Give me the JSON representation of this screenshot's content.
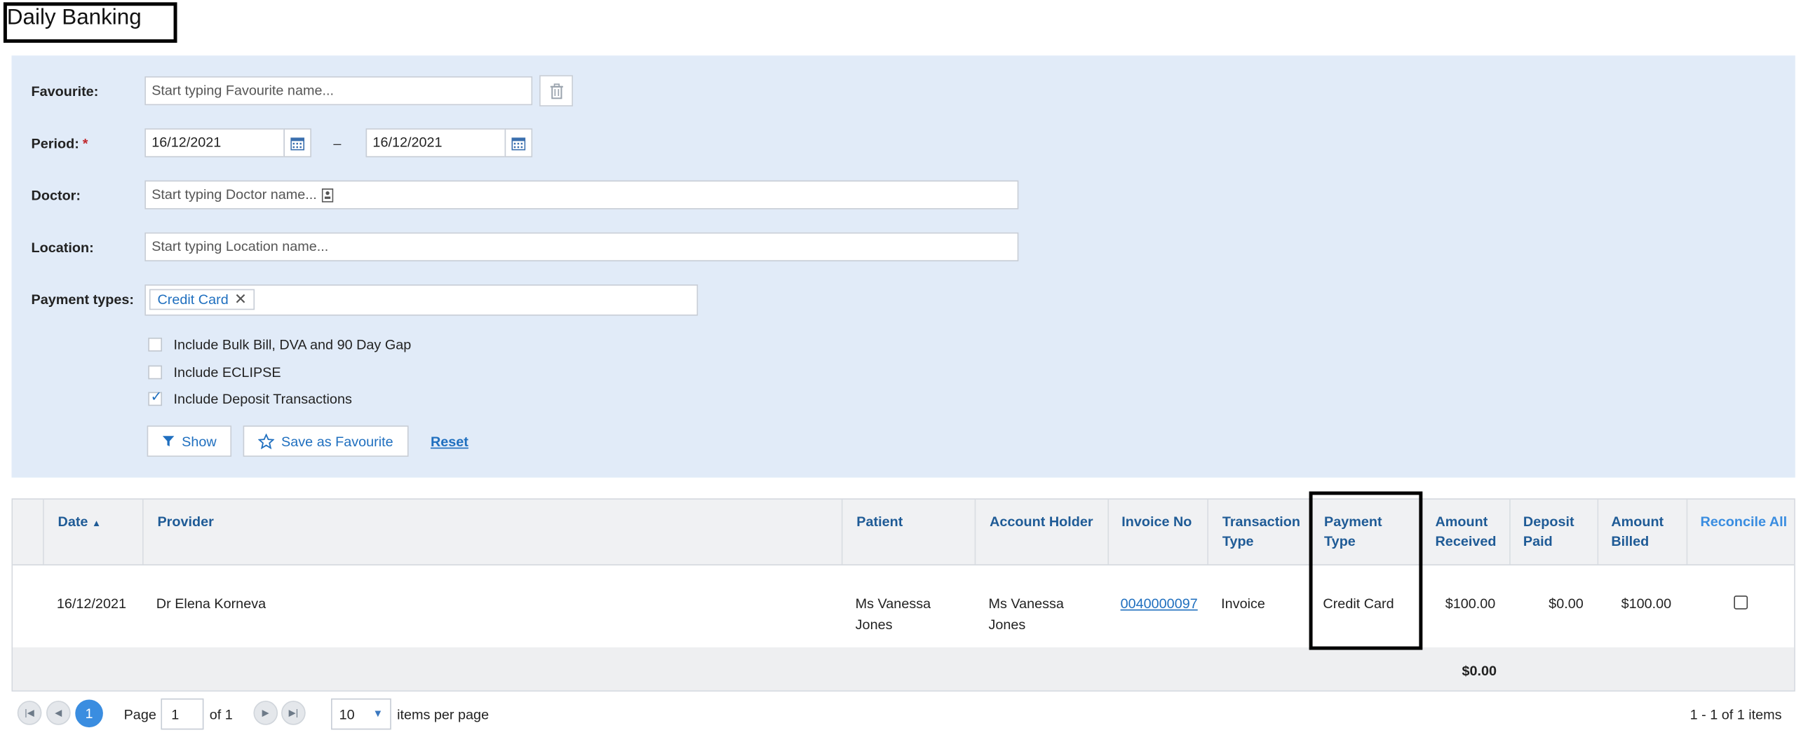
{
  "page": {
    "title": "Daily Banking"
  },
  "filters": {
    "favourite": {
      "label": "Favourite:",
      "placeholder": "Start typing Favourite name..."
    },
    "period": {
      "label": "Period:",
      "required_mark": "*",
      "from": "16/12/2021",
      "to": "16/12/2021",
      "separator": "–"
    },
    "doctor": {
      "label": "Doctor:",
      "placeholder": "Start typing Doctor name..."
    },
    "location": {
      "label": "Location:",
      "placeholder": "Start typing Location name..."
    },
    "payment_types": {
      "label": "Payment types:",
      "chips": [
        "Credit Card"
      ]
    },
    "checkboxes": [
      {
        "label": "Include Bulk Bill, DVA and 90 Day Gap",
        "checked": false
      },
      {
        "label": "Include ECLIPSE",
        "checked": false
      },
      {
        "label": "Include Deposit Transactions",
        "checked": true
      }
    ],
    "buttons": {
      "show": "Show",
      "save_favourite": "Save as Favourite",
      "reset": "Reset"
    }
  },
  "grid": {
    "columns": [
      {
        "label": "Date",
        "sort": "asc"
      },
      {
        "label": "Provider"
      },
      {
        "label": "Patient"
      },
      {
        "label": "Account Holder"
      },
      {
        "label": "Invoice No"
      },
      {
        "label": "Transaction Type"
      },
      {
        "label": "Payment Type"
      },
      {
        "label": "Amount Received"
      },
      {
        "label": "Deposit Paid"
      },
      {
        "label": "Amount Billed"
      },
      {
        "label": "Reconcile All"
      }
    ],
    "rows": [
      {
        "date": "16/12/2021",
        "provider": "Dr Elena Korneva",
        "patient": "Ms Vanessa Jones",
        "account_holder": "Ms Vanessa Jones",
        "invoice_no": "0040000097",
        "transaction_type": "Invoice",
        "payment_type": "Credit Card",
        "amount_received": "$100.00",
        "deposit_paid": "$0.00",
        "amount_billed": "$100.00",
        "reconciled": false
      }
    ],
    "footer": {
      "amount_received_total": "$0.00"
    }
  },
  "pager": {
    "current_page": "1",
    "page_label": "Page",
    "of_label": "of 1",
    "page_size": "10",
    "items_per_page_label": "items per page",
    "summary": "1 - 1 of 1 items"
  },
  "colors": {
    "accent": "#1f6fbf",
    "filter_bg": "#e1ebf8",
    "header_text": "#1f5b96",
    "required": "#c0282d"
  }
}
